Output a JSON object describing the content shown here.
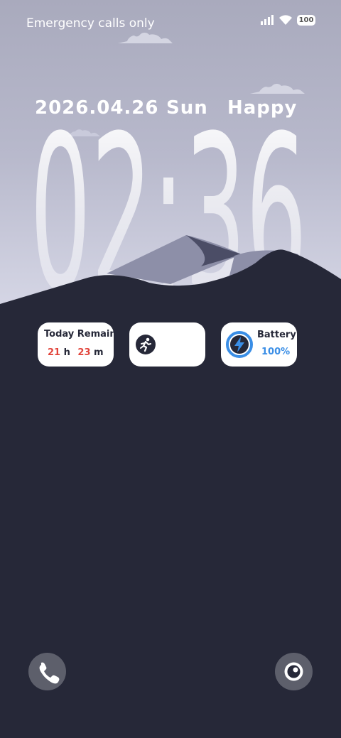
{
  "status_bar": {
    "carrier_text": "Emergency calls only",
    "battery_level": "100"
  },
  "lockscreen": {
    "date": "2026.04.26",
    "weekday": "Sun",
    "greeting": "Happy",
    "time": "02:36"
  },
  "widgets": {
    "today_remain": {
      "title": "Today Remain",
      "hours": "21",
      "hours_unit": "h",
      "minutes": "23",
      "minutes_unit": "m"
    },
    "battery": {
      "title": "Battery",
      "percent": "100%"
    }
  },
  "icons": [
    "signal-icon",
    "wifi-icon",
    "battery-icon",
    "running-icon",
    "bolt-icon",
    "phone-icon",
    "camera-icon"
  ],
  "colors": {
    "background": "#262838",
    "accent_red": "#e2453c",
    "accent_blue": "#3a8ee6"
  }
}
